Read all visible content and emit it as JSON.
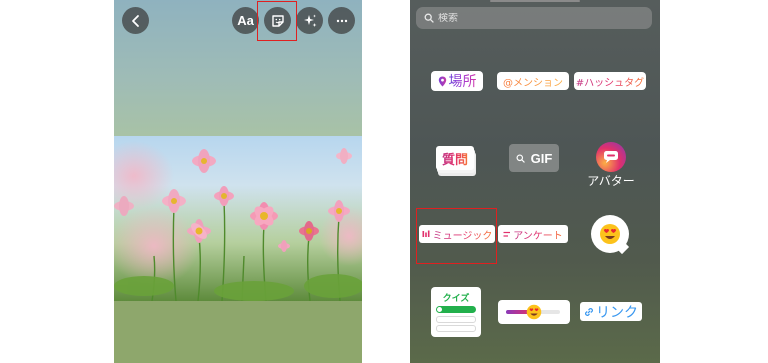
{
  "editor": {
    "back_icon": "chevron-left-icon",
    "text_tool_label": "Aa",
    "sticker_icon": "sticker-icon",
    "effects_icon": "sparkles-icon",
    "more_icon": "more-horizontal-icon"
  },
  "sticker_tray": {
    "search": {
      "placeholder": "検索"
    },
    "stickers": {
      "location": "場所",
      "mention": "@メンション",
      "hashtag": "#ハッシュタグ",
      "question": "質問",
      "gif": "GIF",
      "avatar": "アバター",
      "music": "ミュージック",
      "poll": "アンケート",
      "quiz": "クイズ",
      "link": "リンク"
    }
  },
  "colors": {
    "highlight": "#e02020",
    "accent_pink": "#e1306c",
    "accent_purple": "#8a3ab9",
    "accent_orange": "#f77737",
    "quiz_green": "#22b04c"
  }
}
